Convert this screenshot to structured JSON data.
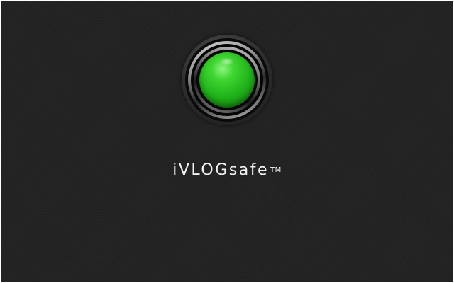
{
  "app": {
    "brand_name": "iVLOGsafe",
    "trademark": "TM"
  },
  "status_light": {
    "icon": "green-status-light-icon",
    "color": "#21b41a"
  },
  "theme": {
    "background": "#232323",
    "text": "#f2f2f2"
  }
}
